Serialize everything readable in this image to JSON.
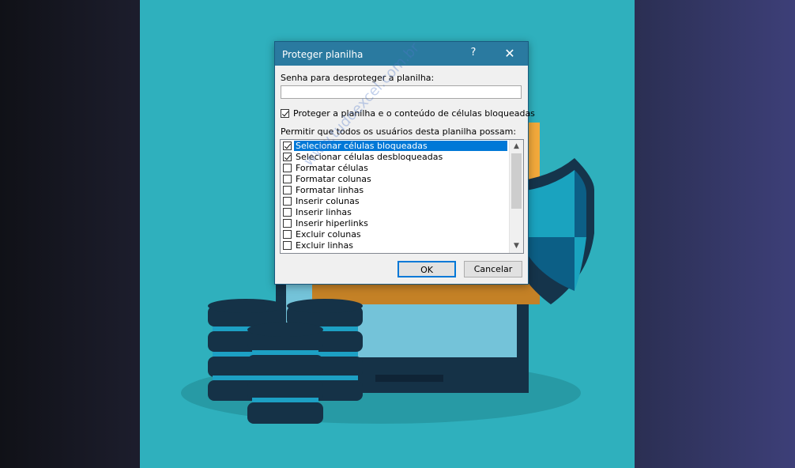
{
  "dialog": {
    "title": "Proteger planilha",
    "help_label": "?",
    "close_label": "✕",
    "password_label": "Senha para desproteger a planilha:",
    "password_value": "",
    "protect_label": "Proteger a planilha e o conteúdo de células bloqueadas",
    "protect_checked": true,
    "permissions_label": "Permitir que todos os usuários desta planilha possam:",
    "permissions": [
      {
        "label": "Selecionar células bloqueadas",
        "checked": true,
        "selected": true
      },
      {
        "label": "Selecionar células desbloqueadas",
        "checked": true,
        "selected": false
      },
      {
        "label": "Formatar células",
        "checked": false,
        "selected": false
      },
      {
        "label": "Formatar colunas",
        "checked": false,
        "selected": false
      },
      {
        "label": "Formatar linhas",
        "checked": false,
        "selected": false
      },
      {
        "label": "Inserir colunas",
        "checked": false,
        "selected": false
      },
      {
        "label": "Inserir linhas",
        "checked": false,
        "selected": false
      },
      {
        "label": "Inserir hiperlinks",
        "checked": false,
        "selected": false
      },
      {
        "label": "Excluir colunas",
        "checked": false,
        "selected": false
      },
      {
        "label": "Excluir linhas",
        "checked": false,
        "selected": false
      }
    ],
    "scroll_up_icon": "▲",
    "scroll_down_icon": "▼",
    "ok_label": "OK",
    "cancel_label": "Cancelar"
  },
  "watermark": "www.tudoexcel.com.br",
  "colors": {
    "panel": "#2fb0bd",
    "titlebar": "#2a7aa0",
    "selection": "#0078d7",
    "folder": "#f2a93b",
    "database": "#153247"
  }
}
